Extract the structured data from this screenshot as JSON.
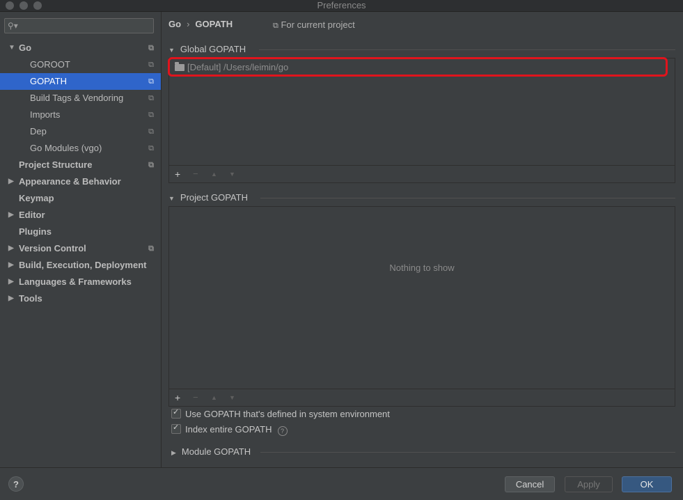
{
  "window": {
    "title": "Preferences"
  },
  "sidebar": {
    "items": [
      {
        "label": "Go",
        "arrow": "▼",
        "bold": true,
        "indent": 0,
        "scope_icon": "copy-icon"
      },
      {
        "label": "GOROOT",
        "indent": 1,
        "scope_icon": "copy-icon"
      },
      {
        "label": "GOPATH",
        "indent": 1,
        "selected": true,
        "scope_icon": "copy-icon"
      },
      {
        "label": "Build Tags & Vendoring",
        "indent": 1,
        "scope_icon": "copy-icon"
      },
      {
        "label": "Imports",
        "indent": 1,
        "scope_icon": "copy-icon"
      },
      {
        "label": "Dep",
        "indent": 1,
        "scope_icon": "copy-icon"
      },
      {
        "label": "Go Modules (vgo)",
        "indent": 1,
        "scope_icon": "copy-icon"
      },
      {
        "label": "Project Structure",
        "bold": true,
        "indent": 0,
        "scope_icon": "copy-icon"
      },
      {
        "label": "Appearance & Behavior",
        "arrow": "▶",
        "bold": true,
        "indent": 0
      },
      {
        "label": "Keymap",
        "bold": true,
        "indent": 0
      },
      {
        "label": "Editor",
        "arrow": "▶",
        "bold": true,
        "indent": 0
      },
      {
        "label": "Plugins",
        "bold": true,
        "indent": 0
      },
      {
        "label": "Version Control",
        "arrow": "▶",
        "bold": true,
        "indent": 0,
        "scope_icon": "copy-icon"
      },
      {
        "label": "Build, Execution, Deployment",
        "arrow": "▶",
        "bold": true,
        "indent": 0
      },
      {
        "label": "Languages & Frameworks",
        "arrow": "▶",
        "bold": true,
        "indent": 0
      },
      {
        "label": "Tools",
        "arrow": "▶",
        "bold": true,
        "indent": 0
      }
    ]
  },
  "header": {
    "breadcrumb_root": "Go",
    "breadcrumb_sep": "›",
    "breadcrumb_leaf": "GOPATH",
    "scope_label": "For current project"
  },
  "global_gopath": {
    "title": "Global GOPATH",
    "entries": [
      "[Default] /Users/leimin/go"
    ],
    "highlight_color": "#e0141d"
  },
  "project_gopath": {
    "title": "Project GOPATH",
    "empty_text": "Nothing to show"
  },
  "toolbar": {
    "add": "+",
    "remove": "−",
    "up": "▲",
    "down": "▼"
  },
  "options": {
    "use_system_env": {
      "label": "Use GOPATH that's defined in system environment",
      "checked": true
    },
    "index_entire": {
      "label": "Index entire GOPATH",
      "checked": true
    }
  },
  "module_gopath": {
    "title": "Module GOPATH"
  },
  "footer": {
    "help": "?",
    "cancel": "Cancel",
    "apply": "Apply",
    "ok": "OK"
  },
  "colors": {
    "selection": "#2f65ca",
    "ok_button": "#365880",
    "background": "#3c3f41"
  }
}
